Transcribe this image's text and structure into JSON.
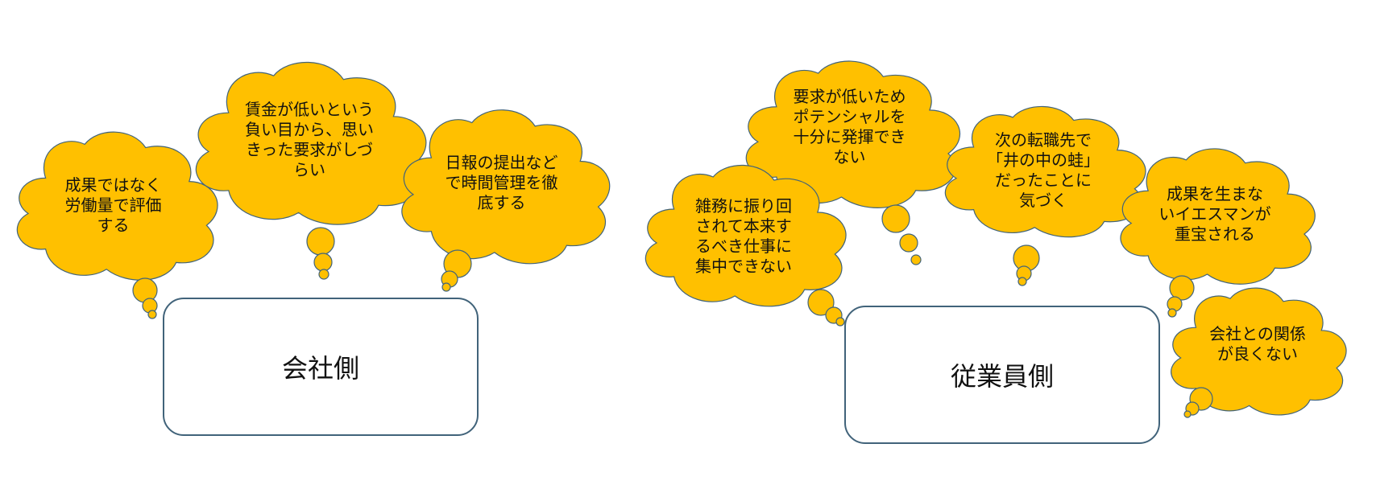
{
  "colors": {
    "cloud_fill": "#ffc000",
    "cloud_stroke": "#41637a",
    "box_stroke": "#41637a"
  },
  "boxes": {
    "company": "会社側",
    "employee": "従業員側"
  },
  "clouds": {
    "c1": "成果ではなく\n労働量で評価\nする",
    "c2": "賃金が低いという\n負い目から、思い\nきった要求がしづ\nらい",
    "c3": "日報の提出など\nで時間管理を徹\n底する",
    "e1": "雑務に振り回\nされて本来す\nるべき仕事に\n集中できない",
    "e2": "要求が低いため\nポテンシャルを\n十分に発揮でき\nない",
    "e3": "次の転職先で\n「井の中の蛙」\nだったことに\n気づく",
    "e4": "成果を生まな\nいイエスマンが\n重宝される",
    "e5": "会社との関係\nが良くない"
  }
}
